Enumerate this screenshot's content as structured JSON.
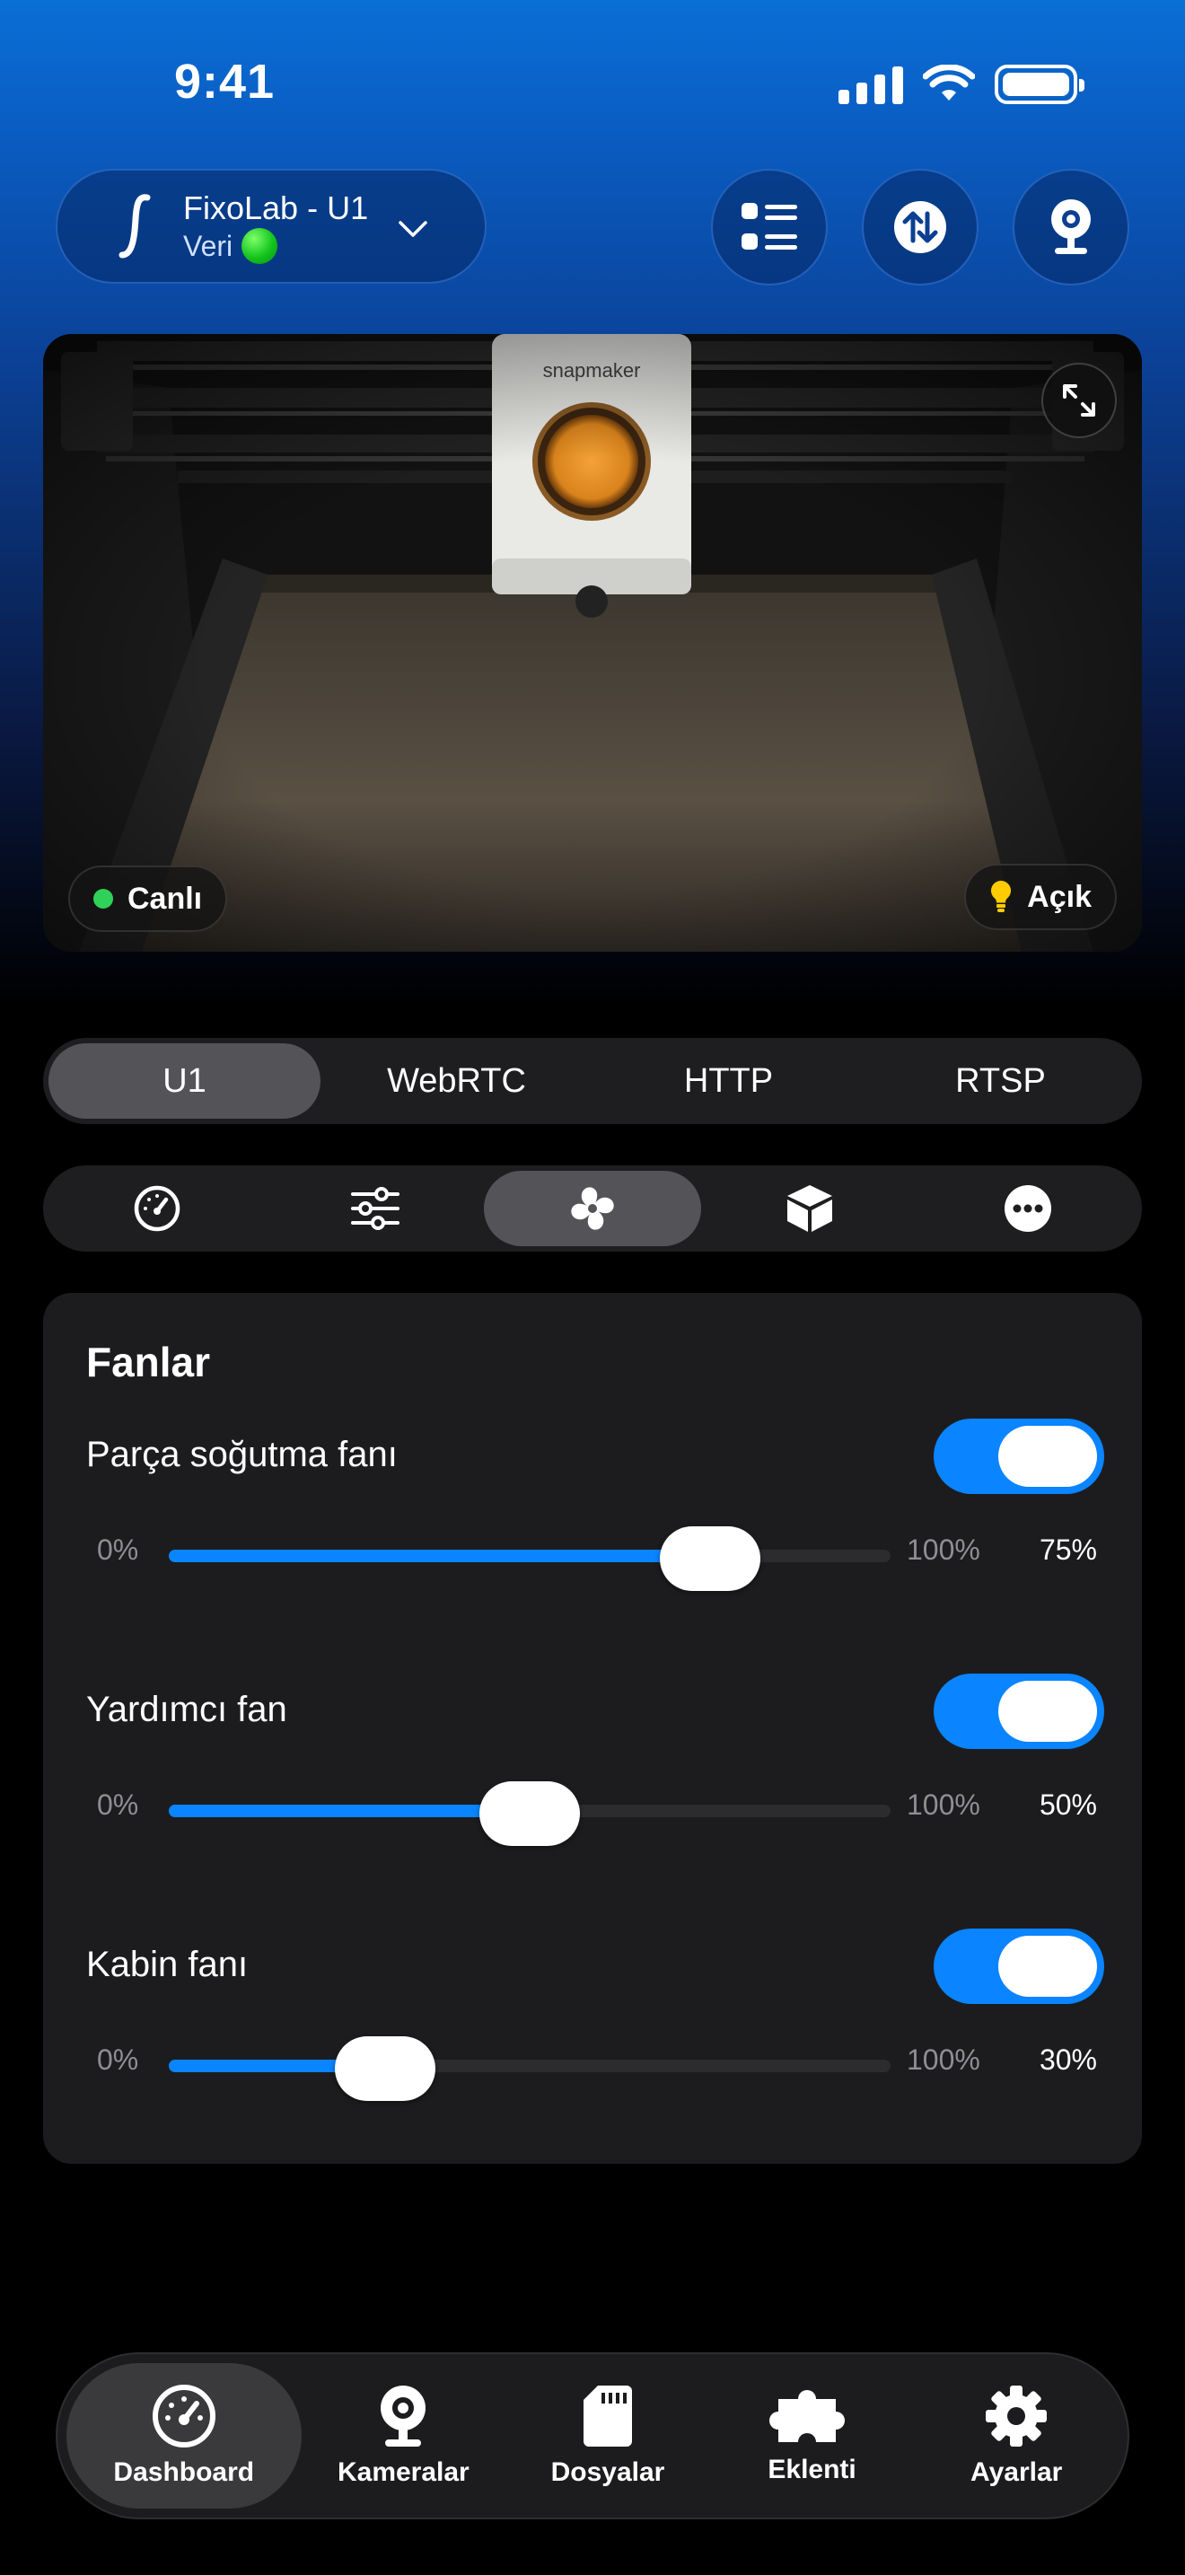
{
  "status_bar": {
    "time": "9:41"
  },
  "header": {
    "printer_name": "FixoLab - U1",
    "printer_sub": "Veri",
    "icons": [
      "logo-icon",
      "list-icon",
      "transfer-icon",
      "webcam-icon",
      "chevron-down-icon"
    ]
  },
  "camera": {
    "live_label": "Canlı",
    "light_label": "Açık",
    "brand_text": "snapmaker"
  },
  "stream_tabs": [
    {
      "label": "U1",
      "active": true
    },
    {
      "label": "WebRTC",
      "active": false
    },
    {
      "label": "HTTP",
      "active": false
    },
    {
      "label": "RTSP",
      "active": false
    }
  ],
  "control_tabs": [
    {
      "icon": "gauge-icon",
      "active": false
    },
    {
      "icon": "sliders-icon",
      "active": false
    },
    {
      "icon": "fan-icon",
      "active": true
    },
    {
      "icon": "box-icon",
      "active": false
    },
    {
      "icon": "more-icon",
      "active": false
    }
  ],
  "fans": {
    "title": "Fanlar",
    "items": [
      {
        "name": "Parça soğutma fanı",
        "enabled": true,
        "min": "0%",
        "max": "100%",
        "value_label": "75%",
        "value": 0.75
      },
      {
        "name": "Yardımcı fan",
        "enabled": true,
        "min": "0%",
        "max": "100%",
        "value_label": "50%",
        "value": 0.5
      },
      {
        "name": "Kabin fanı",
        "enabled": true,
        "min": "0%",
        "max": "100%",
        "value_label": "30%",
        "value": 0.3
      }
    ]
  },
  "bottom_nav": [
    {
      "label": "Dashboard",
      "icon": "dashboard-icon",
      "active": true
    },
    {
      "label": "Kameralar",
      "icon": "camera-icon",
      "active": false
    },
    {
      "label": "Dosyalar",
      "icon": "sd-card-icon",
      "active": false
    },
    {
      "label": "Eklenti",
      "icon": "puzzle-icon",
      "active": false
    },
    {
      "label": "Ayarlar",
      "icon": "gear-icon",
      "active": false
    }
  ],
  "colors": {
    "accent": "#0a84ff",
    "card": "#1c1c1e",
    "live": "#30d158"
  }
}
